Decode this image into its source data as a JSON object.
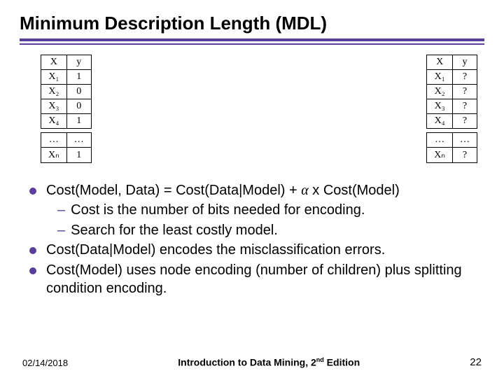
{
  "title": "Minimum Description Length (MDL)",
  "left_table": {
    "headers": [
      "X",
      "y"
    ],
    "rows": [
      [
        "X₁",
        "1"
      ],
      [
        "X₂",
        "0"
      ],
      [
        "X₃",
        "0"
      ],
      [
        "X₄",
        "1"
      ],
      [
        "…",
        "…"
      ],
      [
        "Xₙ",
        "1"
      ]
    ]
  },
  "right_table": {
    "headers": [
      "X",
      "y"
    ],
    "rows": [
      [
        "X₁",
        "?"
      ],
      [
        "X₂",
        "?"
      ],
      [
        "X₃",
        "?"
      ],
      [
        "X₄",
        "?"
      ],
      [
        "…",
        "…"
      ],
      [
        "Xₙ",
        "?"
      ]
    ]
  },
  "bullets": [
    {
      "text_pre": "Cost(Model, Data) = Cost(Data|Model) + ",
      "alpha": "α",
      "text_post": " x Cost(Model)",
      "subs": [
        "Cost is the number of bits needed for encoding.",
        "Search for the least costly model."
      ]
    },
    {
      "text": "Cost(Data|Model) encodes the misclassification errors."
    },
    {
      "text": "Cost(Model) uses node encoding (number of children) plus splitting condition encoding."
    }
  ],
  "footer": {
    "date": "02/14/2018",
    "center_pre": "Introduction to Data Mining, 2",
    "center_sup": "nd",
    "center_post": " Edition",
    "page": "22"
  }
}
